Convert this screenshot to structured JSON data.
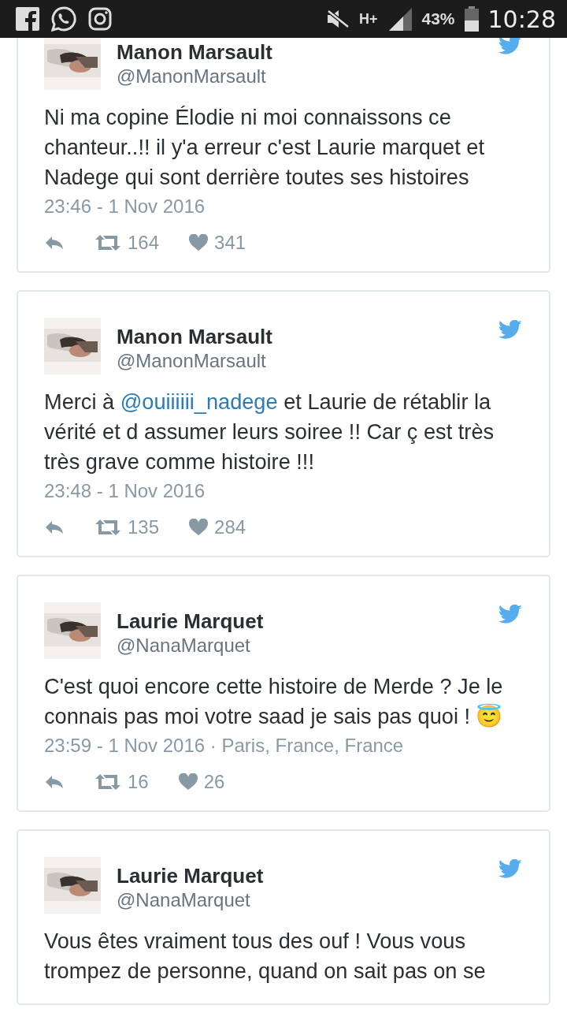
{
  "status_bar": {
    "network": "H+",
    "battery": "43%",
    "time": "10:28"
  },
  "tweets": [
    {
      "name": "Manon Marsault",
      "handle": "@ManonMarsault",
      "avatar": {
        "kind": "picture"
      },
      "text": [
        {
          "kind": "text",
          "text": "Ni ma copine Élodie ni moi connaissons ce chanteur..!! il y'a erreur c'est Laurie marquet et Nadege qui sont derrière toutes ses histoires"
        }
      ],
      "date": "23:46 - 1 Nov 2016",
      "retweets": "164",
      "likes": "341"
    },
    {
      "name": "Manon Marsault",
      "handle": "@ManonMarsault",
      "avatar": {
        "kind": "picture"
      },
      "text": [
        {
          "kind": "text",
          "text": "Merci à "
        },
        {
          "kind": "mention",
          "text": "@ouiiiiii_nadege"
        },
        {
          "kind": "text",
          "text": " et Laurie de rétablir la vérité et d assumer leurs soiree !! Car ç est très très grave comme histoire !!!"
        }
      ],
      "date": "23:48 - 1 Nov 2016",
      "retweets": "135",
      "likes": "284"
    },
    {
      "name": "Laurie Marquet",
      "handle": "@NanaMarquet",
      "avatar": {
        "kind": "picture"
      },
      "text": [
        {
          "kind": "text",
          "text": "C'est quoi encore cette histoire de Merde ? Je le connais pas moi votre saad je sais pas quoi ! 😇"
        }
      ],
      "date": "23:59 - 1 Nov 2016 · Paris, France, France",
      "retweets": "16",
      "likes": "26"
    },
    {
      "name": "Laurie Marquet",
      "handle": "@NanaMarquet",
      "avatar": {
        "kind": "picture"
      },
      "text": [
        {
          "kind": "text",
          "text": "Vous êtes vraiment tous des ouf ! Vous vous trompez de personne, quand on sait pas on se"
        }
      ]
    }
  ]
}
